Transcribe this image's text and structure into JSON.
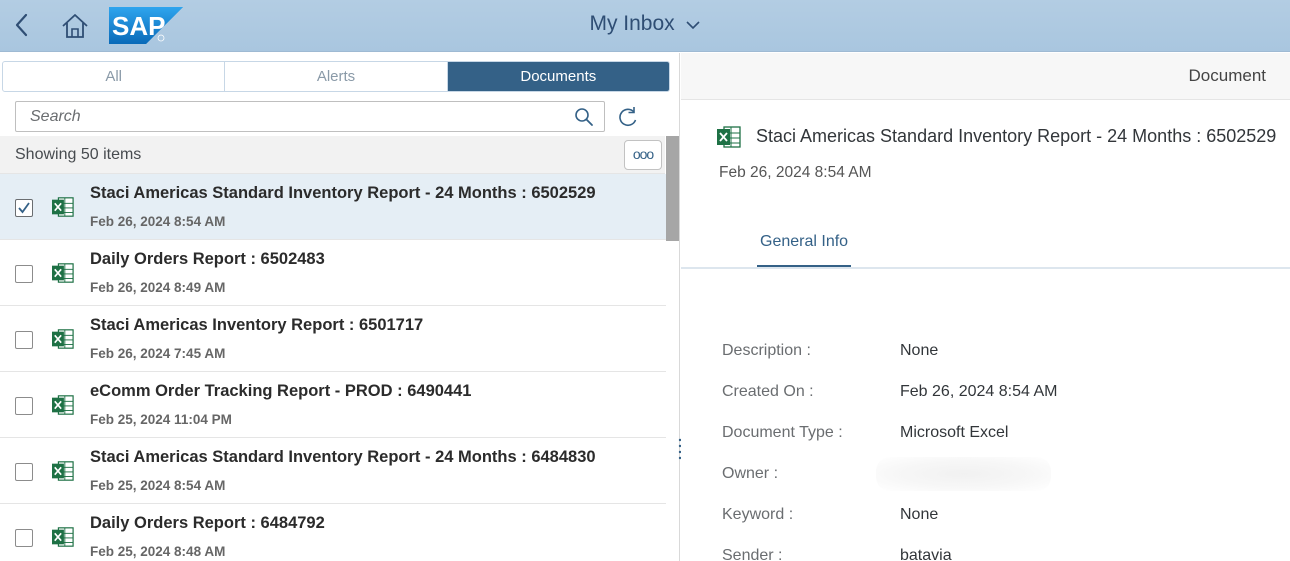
{
  "shell": {
    "title": "My Inbox",
    "logo_text": "SAP",
    "colors": {
      "bar": "#aac7df",
      "title": "#2f4e74"
    },
    "icons": [
      "back-icon",
      "home-icon",
      "chevron-down-icon"
    ]
  },
  "master": {
    "tabs": [
      {
        "label": "All",
        "active": false
      },
      {
        "label": "Alerts",
        "active": false
      },
      {
        "label": "Documents",
        "active": true
      }
    ],
    "search": {
      "placeholder": "Search",
      "value": ""
    },
    "info_text": "Showing 50 items",
    "more_label": "ooo",
    "items": [
      {
        "title": "Staci Americas Standard Inventory Report - 24 Months : 6502529",
        "date": "Feb 26, 2024 8:54 AM",
        "checked": true,
        "selected": true
      },
      {
        "title": "Daily Orders Report : 6502483",
        "date": "Feb 26, 2024 8:49 AM",
        "checked": false,
        "selected": false
      },
      {
        "title": "Staci Americas Inventory Report : 6501717",
        "date": "Feb 26, 2024 7:45 AM",
        "checked": false,
        "selected": false
      },
      {
        "title": "eComm Order Tracking Report - PROD : 6490441",
        "date": "Feb 25, 2024 11:04 PM",
        "checked": false,
        "selected": false
      },
      {
        "title": "Staci Americas Standard Inventory Report - 24 Months : 6484830",
        "date": "Feb 25, 2024 8:54 AM",
        "checked": false,
        "selected": false
      },
      {
        "title": "Daily Orders Report : 6484792",
        "date": "Feb 25, 2024 8:48 AM",
        "checked": false,
        "selected": false
      }
    ]
  },
  "detail": {
    "header_title": "Document",
    "object_title": "Staci Americas Standard Inventory Report - 24 Months : 6502529",
    "object_date": "Feb 26, 2024 8:54 AM",
    "tab_label": "General Info",
    "fields": [
      {
        "label": "Description :",
        "value": "None"
      },
      {
        "label": "Created On :",
        "value": "Feb 26, 2024 8:54 AM"
      },
      {
        "label": "Document Type :",
        "value": "Microsoft Excel"
      },
      {
        "label": "Owner :",
        "value": ""
      },
      {
        "label": "Keyword :",
        "value": "None"
      },
      {
        "label": "Sender :",
        "value": "batavia"
      }
    ]
  }
}
